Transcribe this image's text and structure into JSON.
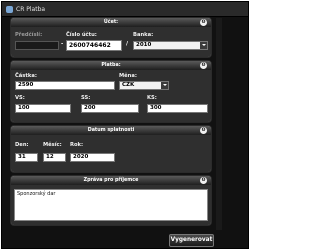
{
  "window": {
    "title": "CR Platba"
  },
  "account": {
    "header": "Účet:",
    "prefix_label": "Předčíslí:",
    "prefix_value": "",
    "number_label": "Číslo účtu:",
    "number_value": "2600746462",
    "bank_label": "Banka:",
    "bank_value": "2010",
    "separator_dash": "-",
    "separator_slash": "/"
  },
  "payment": {
    "header": "Platba:",
    "amount_label": "Částka:",
    "amount_value": "2590",
    "currency_label": "Měna:",
    "currency_value": "CZK",
    "vs_label": "VS:",
    "vs_value": "100",
    "ss_label": "SS:",
    "ss_value": "200",
    "ks_label": "KS:",
    "ks_value": "300"
  },
  "due": {
    "header": "Datum splatnosti",
    "day_label": "Den:",
    "day_value": "31",
    "month_label": "Měsíc:",
    "month_value": "12",
    "year_label": "Rok:",
    "year_value": "2020"
  },
  "message": {
    "header": "Zpráva pro příjemce",
    "text": "Sponzorský dar"
  },
  "collapse_symbol": "ʘ",
  "submit_label": "Vygenerovat",
  "icons": {
    "app": "qr-app-icon",
    "collapse": "collapse-icon",
    "dropdown": "chevron-down-icon"
  }
}
